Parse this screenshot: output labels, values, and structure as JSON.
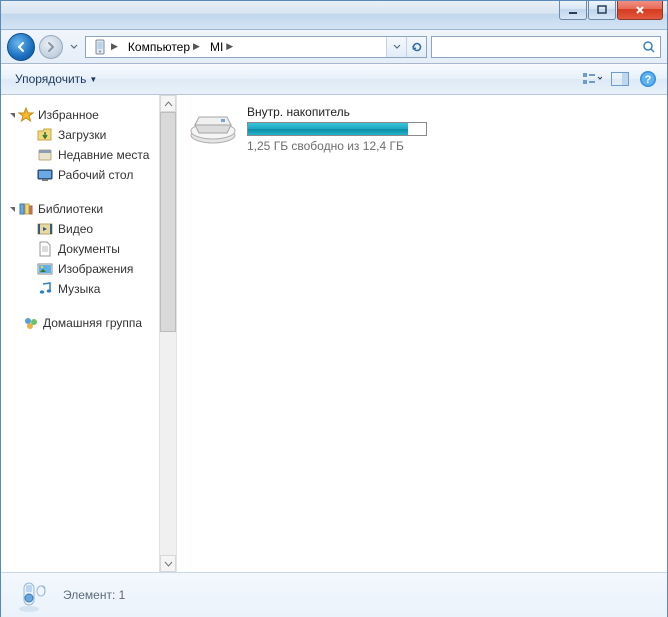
{
  "breadcrumbs": [
    "Компьютер",
    "MI"
  ],
  "toolbar": {
    "organize": "Упорядочить"
  },
  "sidebar": {
    "favorites": {
      "title": "Избранное",
      "items": [
        "Загрузки",
        "Недавние места",
        "Рабочий стол"
      ]
    },
    "libraries": {
      "title": "Библиотеки",
      "items": [
        "Видео",
        "Документы",
        "Изображения",
        "Музыка"
      ]
    },
    "homegroup": {
      "title": "Домашняя группа"
    }
  },
  "content": {
    "drive_name": "Внутр. накопитель",
    "drive_sub": "1,25 ГБ свободно из 12,4 ГБ"
  },
  "status": {
    "text": "Элемент: 1"
  }
}
